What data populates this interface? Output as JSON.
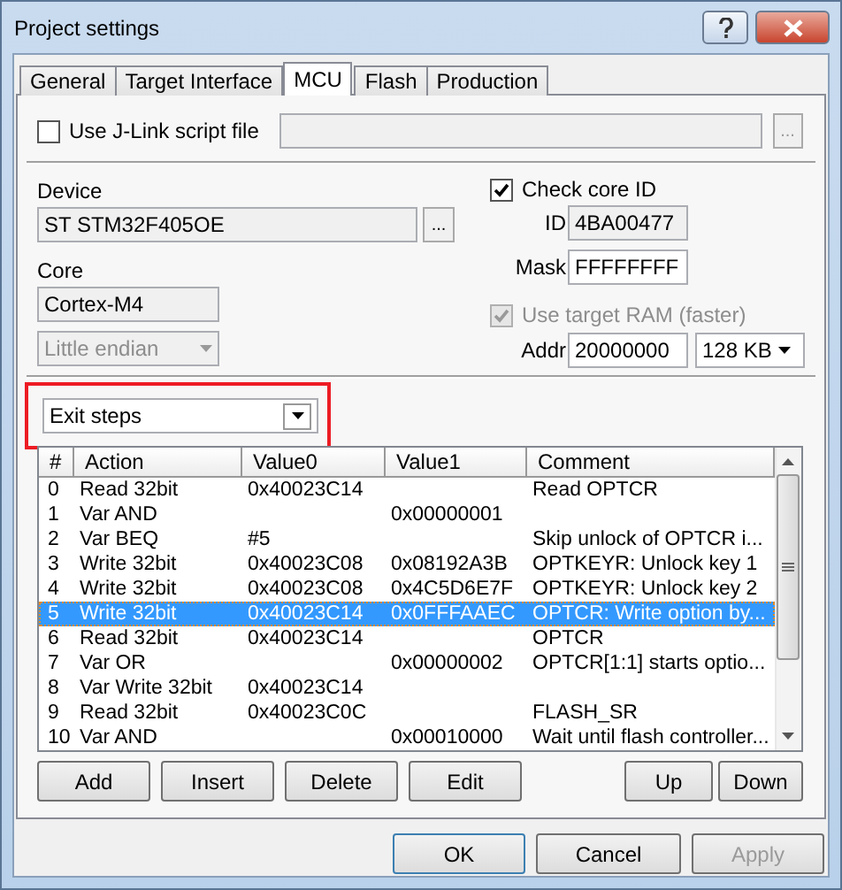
{
  "window": {
    "title": "Project settings"
  },
  "tabs": [
    {
      "label": "General",
      "selected": false
    },
    {
      "label": "Target Interface",
      "selected": false
    },
    {
      "label": "MCU",
      "selected": true
    },
    {
      "label": "Flash",
      "selected": false
    },
    {
      "label": "Production",
      "selected": false
    }
  ],
  "jlink_script": {
    "label": "Use J-Link script file",
    "checked": false,
    "browse": "..."
  },
  "device": {
    "label": "Device",
    "value": "ST STM32F405OE",
    "browse": "..."
  },
  "core": {
    "label": "Core",
    "value": "Cortex-M4",
    "endianness": "Little endian"
  },
  "check_core_id": {
    "label": "Check core ID",
    "checked": true,
    "id_label": "ID",
    "id_value": "4BA00477",
    "mask_label": "Mask",
    "mask_value": "FFFFFFFF"
  },
  "target_ram": {
    "label": "Use target RAM (faster)",
    "checked": true,
    "disabled": true,
    "addr_label": "Addr",
    "addr_value": "20000000",
    "size": "128 KB"
  },
  "steps": {
    "value": "Exit steps",
    "highlighted": true
  },
  "table": {
    "columns": [
      "#",
      "Action",
      "Value0",
      "Value1",
      "Comment"
    ],
    "rows": [
      {
        "cells": [
          "0",
          "Read 32bit",
          "0x40023C14",
          "",
          "Read OPTCR"
        ],
        "selected": false
      },
      {
        "cells": [
          "1",
          "Var AND",
          "",
          "0x00000001",
          ""
        ],
        "selected": false
      },
      {
        "cells": [
          "2",
          "Var BEQ",
          "#5",
          "",
          "Skip unlock of OPTCR i..."
        ],
        "selected": false
      },
      {
        "cells": [
          "3",
          "Write 32bit",
          "0x40023C08",
          "0x08192A3B",
          "OPTKEYR: Unlock key 1"
        ],
        "selected": false
      },
      {
        "cells": [
          "4",
          "Write 32bit",
          "0x40023C08",
          "0x4C5D6E7F",
          "OPTKEYR: Unlock key 2"
        ],
        "selected": false
      },
      {
        "cells": [
          "5",
          "Write 32bit",
          "0x40023C14",
          "0x0FFFAAEC",
          "OPTCR: Write option by..."
        ],
        "selected": true
      },
      {
        "cells": [
          "6",
          "Read 32bit",
          "0x40023C14",
          "",
          "OPTCR"
        ],
        "selected": false
      },
      {
        "cells": [
          "7",
          "Var OR",
          "",
          "0x00000002",
          "OPTCR[1:1] starts optio..."
        ],
        "selected": false
      },
      {
        "cells": [
          "8",
          "Var Write 32bit",
          "0x40023C14",
          "",
          ""
        ],
        "selected": false
      },
      {
        "cells": [
          "9",
          "Read 32bit",
          "0x40023C0C",
          "",
          "FLASH_SR"
        ],
        "selected": false
      },
      {
        "cells": [
          "10",
          "Var AND",
          "",
          "0x00010000",
          "Wait until flash controller..."
        ],
        "selected": false
      }
    ]
  },
  "step_buttons": {
    "left": [
      "Add",
      "Insert",
      "Delete",
      "Edit"
    ],
    "right": [
      "Up",
      "Down"
    ]
  },
  "dialog_buttons": [
    {
      "label": "OK",
      "disabled": false,
      "default": true
    },
    {
      "label": "Cancel",
      "disabled": false,
      "default": false
    },
    {
      "label": "Apply",
      "disabled": true,
      "default": false
    }
  ]
}
